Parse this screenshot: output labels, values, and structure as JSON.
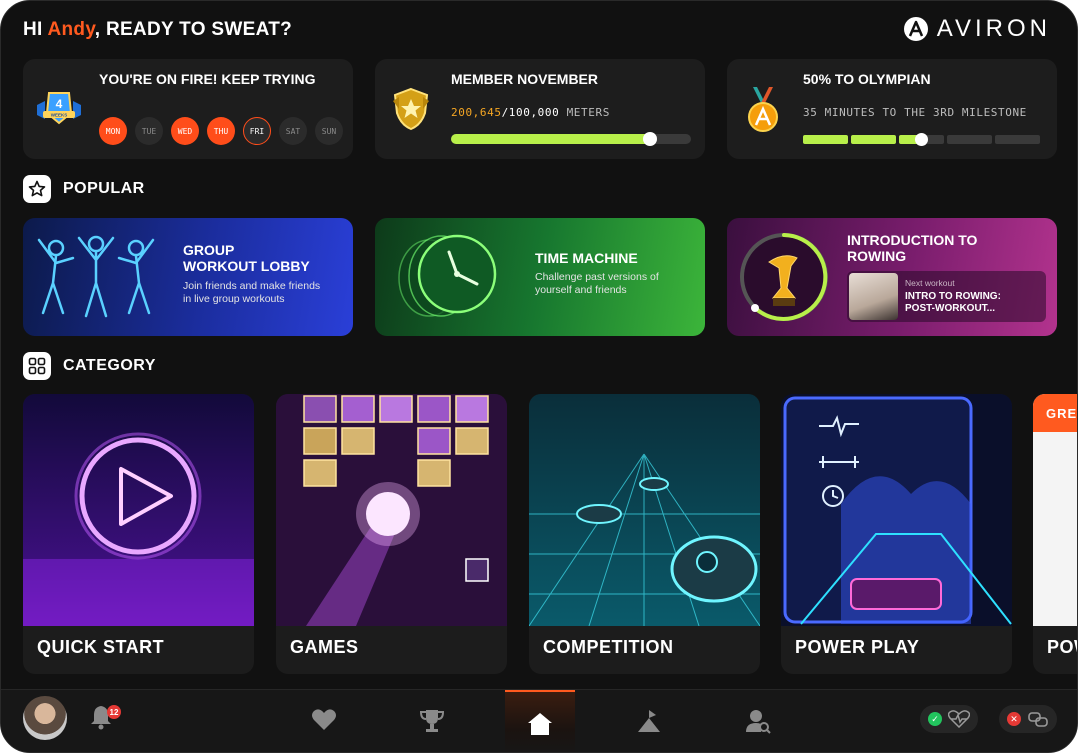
{
  "header": {
    "greeting_prefix": "HI ",
    "user_name": "Andy",
    "greeting_suffix": ", READY TO SWEAT?",
    "brand": "AVIRON"
  },
  "stats": {
    "streak": {
      "title": "YOU'RE ON FIRE! KEEP TRYING",
      "weeks_value": "4",
      "weeks_label": "WEEKS",
      "days": [
        {
          "label": "MON",
          "state": "done"
        },
        {
          "label": "TUE",
          "state": "idle"
        },
        {
          "label": "WED",
          "state": "done"
        },
        {
          "label": "THU",
          "state": "done"
        },
        {
          "label": "FRI",
          "state": "today"
        },
        {
          "label": "SAT",
          "state": "idle"
        },
        {
          "label": "SUN",
          "state": "idle"
        }
      ]
    },
    "member": {
      "title": "MEMBER NOVEMBER",
      "current": "200,645",
      "sep": "/",
      "target": "100,000",
      "unit": " METERS",
      "progress": 0.83
    },
    "olympian": {
      "title": "50% TO OLYMPIAN",
      "sub": "35 MINUTES TO THE 3RD MILESTONE",
      "segments_total": 5,
      "segments_done": 2,
      "current_segment_fill": 0.48
    }
  },
  "sections": {
    "popular": "POPULAR",
    "category": "CATEGORY"
  },
  "popular": [
    {
      "title_line1": "GROUP",
      "title_line2": "WORKOUT LOBBY",
      "desc_line1": "Join friends and make friends",
      "desc_line2": "in live group workouts"
    },
    {
      "title_line1": "TIME MACHINE",
      "desc_line1": "Challenge past versions of",
      "desc_line2": "yourself and friends"
    },
    {
      "title_line1": "INTRODUCTION TO",
      "title_line2": "ROWING",
      "next_label": "Next workout",
      "next_title_line1": "INTRO TO ROWING:",
      "next_title_line2": "POST-WORKOUT..."
    }
  ],
  "categories": [
    {
      "label": "QUICK START"
    },
    {
      "label": "GAMES"
    },
    {
      "label": "COMPETITION"
    },
    {
      "label": "POWER PLAY"
    },
    {
      "label": "POW",
      "tag": "GRE"
    }
  ],
  "nav": {
    "notifications": "12",
    "items": [
      "heart-icon",
      "trophy-icon",
      "home-icon",
      "flag-icon",
      "user-search-icon"
    ],
    "active": "home-icon"
  },
  "colors": {
    "accent": "#ff5a1f",
    "progress": "#b8ef4a",
    "status_ok": "#22c55e",
    "status_error": "#e53935"
  }
}
